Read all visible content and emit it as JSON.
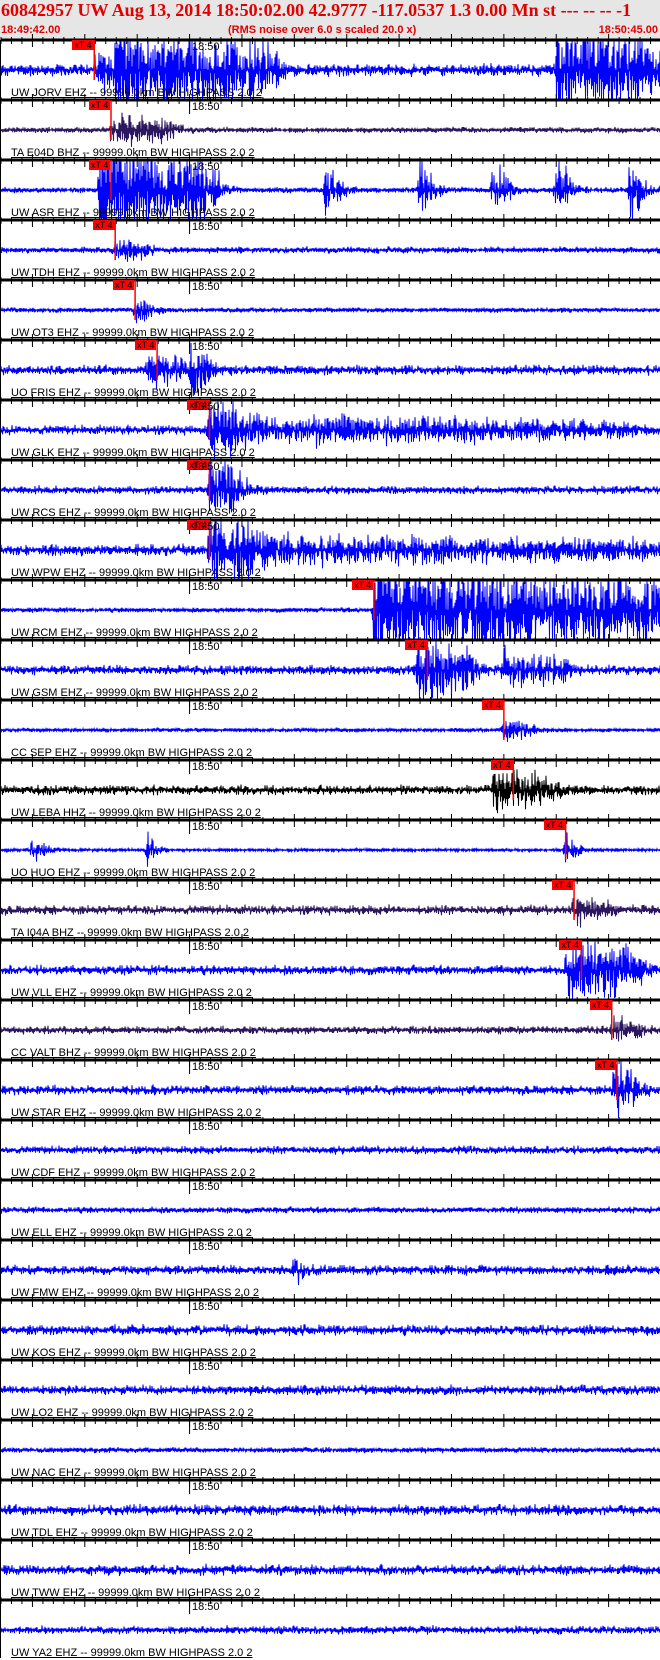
{
  "header": {
    "title": "60842957 UW Aug 13, 2014 18:50:02.00   42.9777 -117.0537  1.3 0.00 Mn st --- -- --  -1",
    "start_time": "18:49:42.00",
    "end_time": "18:50:45.00",
    "note": "(RMS noise over 6.0 s scaled 20.0 x)"
  },
  "colors": {
    "header_text": "#e00000",
    "header_bg": "#e6e6e6",
    "trace_blue": "#0000ff",
    "trace_purple": "#2b1660",
    "trace_black": "#000000",
    "pick": "#ff0000"
  },
  "time_label": "18:50",
  "pick_label": "xT 4",
  "traces": [
    {
      "label": "UW JORV EHZ -- 99999.0km BW  HIGHPASS  2.0  2",
      "color": "#0000ff",
      "noise": 0.15,
      "pick": "18:49:50.9",
      "events": [
        [
          "18:49:51",
          4,
          0.5
        ],
        [
          "18:49:53",
          15,
          1.3
        ],
        [
          "18:50:35",
          10,
          1.3
        ]
      ]
    },
    {
      "label": "TA E04D BHZ -- 99999.0km BW  HIGHPASS  2.0  2",
      "color": "#2b1660",
      "noise": 0.07,
      "pick": "18:49:52.5",
      "events": [
        [
          "18:49:52.5",
          6,
          0.45
        ]
      ]
    },
    {
      "label": "UW ASR EHZ -- 99999.0km BW  HIGHPASS  2.0  2",
      "color": "#0000ff",
      "noise": 0.07,
      "pick": "18:49:52.5",
      "events": [
        [
          "18:49:51.5",
          11,
          1.5
        ],
        [
          "18:50:13",
          1,
          1.0
        ],
        [
          "18:50:22",
          1,
          1.0
        ],
        [
          "18:50:29",
          1,
          1.0
        ],
        [
          "18:50:35",
          1,
          1.0
        ],
        [
          "18:50:42",
          1,
          1.0
        ]
      ]
    },
    {
      "label": "UW TDH EHZ -- 99999.0km BW  HIGHPASS  2.0  2",
      "color": "#0000ff",
      "noise": 0.08,
      "pick": "18:49:52.9",
      "events": [
        [
          "18:49:52.9",
          3,
          0.35
        ]
      ]
    },
    {
      "label": "UW OT3 EHZ -- 99999.0km BW  HIGHPASS  2.0  2",
      "color": "#0000ff",
      "noise": 0.06,
      "pick": "18:49:54.8",
      "events": [
        [
          "18:49:54.8",
          2,
          0.3
        ]
      ]
    },
    {
      "label": "UO FRIS EHZ -- 99999.0km BW  HIGHPASS  2.0  2",
      "color": "#0000ff",
      "noise": 0.12,
      "pick": "18:49:56.9",
      "events": [
        [
          "18:49:56",
          4,
          0.45
        ],
        [
          "18:50:00",
          2,
          0.6
        ]
      ]
    },
    {
      "label": "UW GLK EHZ -- 99999.0km BW  HIGHPASS  2.0  2",
      "color": "#0000ff",
      "noise": 0.12,
      "pick": "18:50:01.9",
      "events": [
        [
          "18:50:01.9",
          3,
          0.8
        ],
        [
          "18:50:04",
          8,
          0.35
        ],
        [
          "18:50:12",
          30,
          0.3
        ]
      ]
    },
    {
      "label": "UW RCS EHZ -- 99999.0km BW  HIGHPASS  2.0  2",
      "color": "#0000ff",
      "noise": 0.1,
      "pick": "18:50:01.9",
      "events": [
        [
          "18:50:01.9",
          3,
          1.0
        ]
      ]
    },
    {
      "label": "UW WPW EHZ -- 99999.0km BW  HIGHPASS  2.0  2",
      "color": "#0000ff",
      "noise": 0.15,
      "pick": "18:50:01.9",
      "events": [
        [
          "18:50:01.9",
          4,
          0.9
        ],
        [
          "18:50:04",
          40,
          0.35
        ]
      ]
    },
    {
      "label": "UW RCM EHZ -- 99999.0km BW  HIGHPASS  2.0  2",
      "color": "#0000ff",
      "noise": 0.06,
      "pick": "18:50:17.6",
      "events": [
        [
          "18:50:17.6",
          30,
          1.8
        ]
      ]
    },
    {
      "label": "UW GSM EHZ -- 99999.0km BW  HIGHPASS  2.0  2",
      "color": "#0000ff",
      "noise": 0.12,
      "pick": "18:50:22.7",
      "events": [
        [
          "18:50:21.8",
          5,
          1.0
        ],
        [
          "18:50:30",
          6,
          0.5
        ]
      ]
    },
    {
      "label": "CC SEP EHZ -- 99999.0km BW  HIGHPASS  2.0  2",
      "color": "#0000ff",
      "noise": 0.05,
      "pick": "18:50:30.0",
      "events": [
        [
          "18:50:30",
          3,
          0.3
        ]
      ]
    },
    {
      "label": "UW LEBA HHZ -- 99999.0km BW  HIGHPASS  2.0  2",
      "color": "#000000",
      "noise": 0.12,
      "pick": "18:50:30.9",
      "events": [
        [
          "18:50:29",
          6,
          0.55
        ]
      ]
    },
    {
      "label": "UO HUO EHZ -- 99999.0km BW  HIGHPASS  2.0  2",
      "color": "#0000ff",
      "noise": 0.04,
      "pick": "18:50:35.9",
      "events": [
        [
          "18:49:45",
          1,
          0.4
        ],
        [
          "18:49:56",
          0.5,
          0.6
        ],
        [
          "18:50:35.9",
          1,
          0.5
        ]
      ]
    },
    {
      "label": "TA I04A BHZ -- 99999.0km BW  HIGHPASS  2.0  2",
      "color": "#2b1660",
      "noise": 0.12,
      "pick": "18:50:36.7",
      "events": [
        [
          "18:50:36.7",
          3,
          0.35
        ]
      ]
    },
    {
      "label": "UW VLL EHZ -- 99999.0km BW  HIGHPASS  2.0  2",
      "color": "#0000ff",
      "noise": 0.12,
      "pick": "18:50:37.4",
      "events": [
        [
          "18:50:36",
          7,
          0.9
        ]
      ]
    },
    {
      "label": "CC VALT BHZ -- 99999.0km BW  HIGHPASS  2.0  2",
      "color": "#2b1660",
      "noise": 0.1,
      "pick": "18:50:40.3",
      "events": [
        [
          "18:50:40.3",
          3,
          0.3
        ]
      ]
    },
    {
      "label": "UW STAR EHZ -- 99999.0km BW  HIGHPASS  2.0  2",
      "color": "#0000ff",
      "noise": 0.12,
      "pick": "18:50:40.8",
      "events": [
        [
          "18:50:40.5",
          2,
          0.8
        ]
      ]
    },
    {
      "label": "UW CDF EHZ -- 99999.0km BW  HIGHPASS  2.0  2",
      "color": "#0000ff",
      "noise": 0.1,
      "events": []
    },
    {
      "label": "UW ELL EHZ -- 99999.0km BW  HIGHPASS  2.0  2",
      "color": "#0000ff",
      "noise": 0.08,
      "events": []
    },
    {
      "label": "UW FMW EHZ -- 99999.0km BW  HIGHPASS  2.0  2",
      "color": "#0000ff",
      "noise": 0.12,
      "events": [
        [
          "18:50:10",
          1,
          0.3
        ]
      ]
    },
    {
      "label": "UW KOS EHZ -- 99999.0km BW  HIGHPASS  2.0  2",
      "color": "#0000ff",
      "noise": 0.13,
      "events": []
    },
    {
      "label": "UW LO2 EHZ -- 99999.0km BW  HIGHPASS  2.0  2",
      "color": "#0000ff",
      "noise": 0.12,
      "events": []
    },
    {
      "label": "UW NAC EHZ -- 99999.0km BW  HIGHPASS  2.0  2",
      "color": "#0000ff",
      "noise": 0.07,
      "events": []
    },
    {
      "label": "UW TDL EHZ -- 99999.0km BW  HIGHPASS  2.0  2",
      "color": "#0000ff",
      "noise": 0.13,
      "events": []
    },
    {
      "label": "UW TWW EHZ -- 99999.0km BW  HIGHPASS  2.0  2",
      "color": "#0000ff",
      "noise": 0.13,
      "events": []
    },
    {
      "label": "UW YA2 EHZ -- 99999.0km BW  HIGHPASS  2.0  2",
      "color": "#0000ff",
      "noise": 0.1,
      "events": []
    }
  ]
}
